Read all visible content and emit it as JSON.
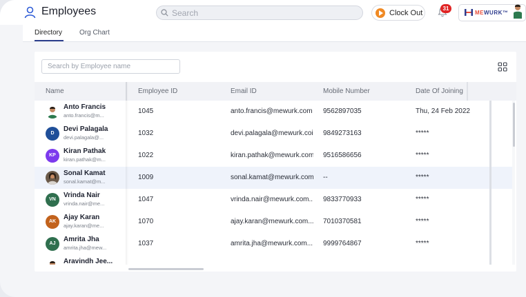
{
  "header": {
    "title": "Employees",
    "search_placeholder": "Search",
    "clock_out_label": "Clock Out",
    "notification_count": "31",
    "brand_prefix": "ME",
    "brand_suffix": "WURK",
    "brand_tm": "™"
  },
  "tabs": [
    {
      "label": "Directory",
      "active": true
    },
    {
      "label": "Org Chart",
      "active": false
    }
  ],
  "directory": {
    "search_placeholder": "Search by Employee name",
    "columns": [
      "Name",
      "Employee ID",
      "Email ID",
      "Mobile Number",
      "Date Of Joining"
    ],
    "rows": [
      {
        "name": "Anto Francis",
        "email_short": "anto.francis@m...",
        "id": "1045",
        "email": "anto.francis@mewurk.com",
        "mobile": "9562897035",
        "doj": "Thu, 24 Feb 2022",
        "avatar": "photo-man",
        "initials": ""
      },
      {
        "name": "Devi Palagala",
        "email_short": "devi.palagala@...",
        "id": "1032",
        "email": "devi.palagala@mewurk.coi",
        "mobile": "9849273163",
        "doj": "*****",
        "avatar": "initials",
        "initials": "D",
        "color": "#1f4f99"
      },
      {
        "name": "Kiran Pathak",
        "email_short": "kiran.pathak@m...",
        "id": "1022",
        "email": "kiran.pathak@mewurk.com",
        "mobile": "9516586656",
        "doj": "*****",
        "avatar": "initials",
        "initials": "KP",
        "color": "#7c3aed"
      },
      {
        "name": "Sonal Kamat",
        "email_short": "sonal.kamat@m...",
        "id": "1009",
        "email": "sonal.kamat@mewurk.com",
        "mobile": "--",
        "doj": "*****",
        "avatar": "photo-woman",
        "initials": ""
      },
      {
        "name": "Vrinda Nair",
        "email_short": "vrinda.nair@me...",
        "id": "1047",
        "email": "vrinda.nair@mewurk.com...",
        "mobile": "9833770933",
        "doj": "*****",
        "avatar": "initials",
        "initials": "VN",
        "color": "#2f6f4e"
      },
      {
        "name": "Ajay Karan",
        "email_short": "ajay.karan@me...",
        "id": "1070",
        "email": "ajay.karan@mewurk.com...",
        "mobile": "7010370581",
        "doj": "*****",
        "avatar": "initials",
        "initials": "AK",
        "color": "#c2621c"
      },
      {
        "name": "Amrita Jha",
        "email_short": "amrita.jha@mew...",
        "id": "1037",
        "email": "amrita.jha@mewurk.com...",
        "mobile": "9999764867",
        "doj": "*****",
        "avatar": "initials",
        "initials": "AJ",
        "color": "#2f6f4e"
      },
      {
        "name": "Aravindh Jee...",
        "email_short": "",
        "id": "",
        "email": "",
        "mobile": "",
        "doj": "",
        "avatar": "photo-man",
        "initials": ""
      }
    ]
  },
  "colors": {
    "accent": "#2c3e8c",
    "clock_out": "#f08a24",
    "badge": "#e02424",
    "row_highlight": "#eff3fb"
  },
  "icons": [
    "user-icon",
    "search-icon",
    "play-icon",
    "bell-icon",
    "grid-view-icon"
  ]
}
